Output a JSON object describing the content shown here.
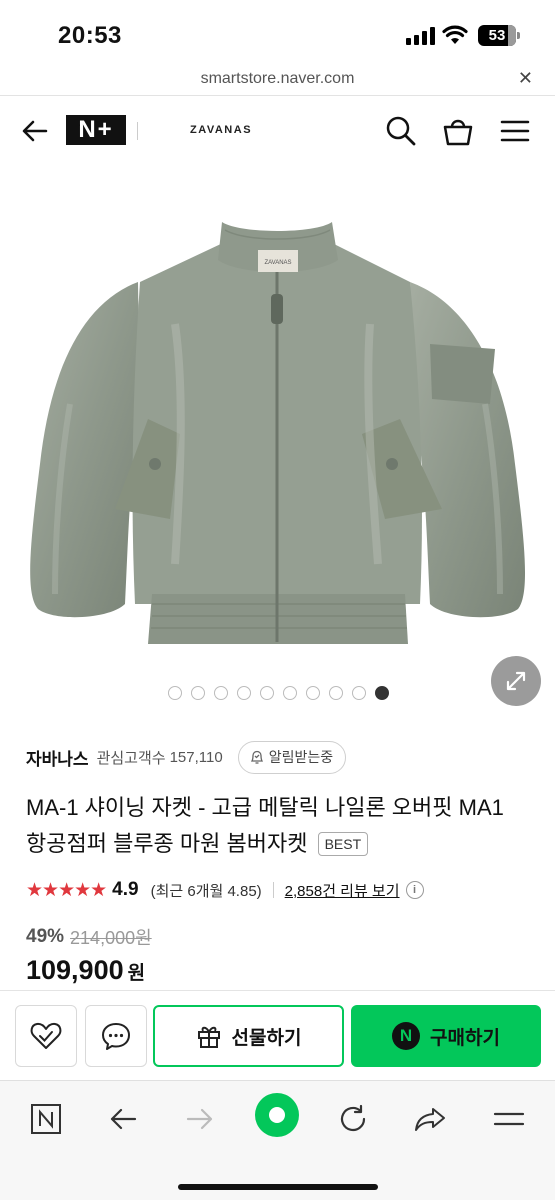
{
  "status_bar": {
    "time": "20:53",
    "battery": "53"
  },
  "url_bar": {
    "url": "smartstore.naver.com",
    "close_icon": "close-icon"
  },
  "header": {
    "logo": "N+",
    "brand": "ZAVANAS",
    "icons": [
      "back-arrow-icon",
      "search-icon",
      "cart-icon",
      "menu-icon"
    ]
  },
  "gallery": {
    "total_images": 10,
    "active_index": 10,
    "expand_icon": "expand-icon",
    "label": "ZAVANAS"
  },
  "seller": {
    "name": "자바나스",
    "follower_label": "관심고객수",
    "follower_count": "157,110",
    "notify_label": "알림받는중"
  },
  "product": {
    "title": "MA-1 샤이닝 자켓 - 고급 메탈릭 나일론 오버핏 MA1 항공점퍼 블루종 마원 봄버자켓",
    "badge": "BEST",
    "stars": "★★★★★",
    "rating": "4.9",
    "recent_rating": "(최근 6개월 4.85)",
    "review_link": "2,858건 리뷰 보기",
    "discount_rate": "49%",
    "original_price": "214,000원",
    "price": "109,900",
    "price_unit": "원"
  },
  "purchase_bar": {
    "gift_label": "선물하기",
    "buy_label": "구매하기",
    "npay_letter": "N",
    "accent_color": "#03c75a"
  },
  "browser_toolbar": {
    "icons": [
      "naver-n-icon",
      "back-icon",
      "forward-icon",
      "green-dot-home-icon",
      "reload-icon",
      "share-icon",
      "menu-icon"
    ]
  }
}
